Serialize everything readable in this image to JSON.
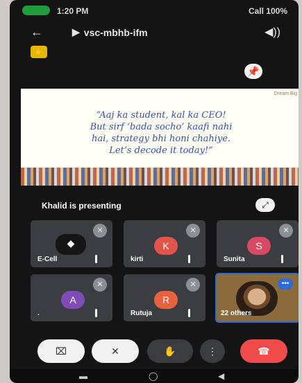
{
  "status": {
    "time": "1:20 PM",
    "battery": "Call 100%"
  },
  "call": {
    "title": "vsc-mbhb-ifm"
  },
  "slide": {
    "corner_label": "Dream Big",
    "quote_lines": [
      "“Aaj ka student, kal ka CEO!",
      "But sirf ‘bada socho’ kaafi nahi",
      "hai, strategy bhi honi chahiye.",
      "Let’s decode it today!”"
    ]
  },
  "presenting": {
    "text": "Khalid is presenting"
  },
  "tiles": [
    {
      "name": "E-Cell",
      "initial": "",
      "color": "#151515"
    },
    {
      "name": "kirti",
      "initial": "K",
      "color": "#e4534a"
    },
    {
      "name": "Sunita",
      "initial": "S",
      "color": "#d64a64"
    },
    {
      "name": ".",
      "initial": "A",
      "color": "#7f4bb6"
    },
    {
      "name": "Rutuja",
      "initial": "R",
      "color": "#e8623f"
    }
  ],
  "video_tile": {
    "label": "22 others"
  },
  "controls": [
    "camera-off",
    "mic-off",
    "raise-hand",
    "more",
    "end-call"
  ],
  "icons": {
    "back": "←",
    "speaker": "◀))",
    "pin": "📌",
    "fullscreen": "⤢",
    "mute": "🎤",
    "dots": "•••"
  }
}
